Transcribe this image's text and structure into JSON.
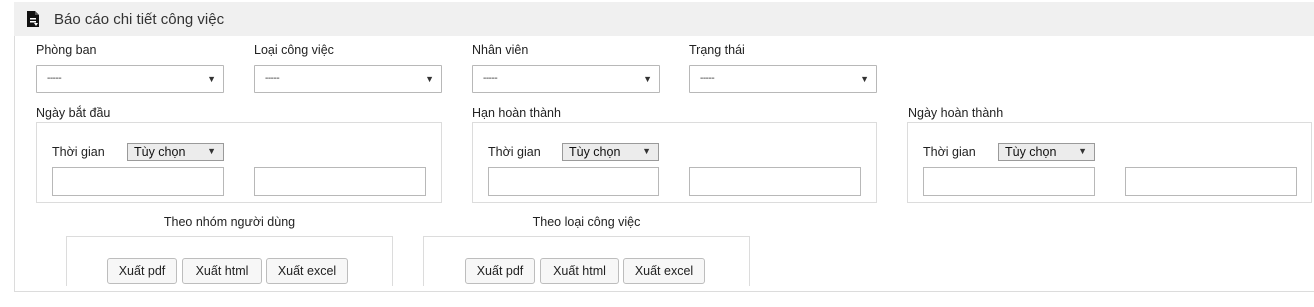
{
  "header": {
    "title": "Báo cáo chi tiết công việc",
    "icon": "report-document-icon"
  },
  "filters": {
    "department": {
      "label": "Phòng ban",
      "value": "-----"
    },
    "task_type": {
      "label": "Loại công việc",
      "value": "-----"
    },
    "employee": {
      "label": "Nhân viên",
      "value": "-----"
    },
    "status": {
      "label": "Trạng thái",
      "value": "-----"
    }
  },
  "date_groups": {
    "start_date": {
      "legend": "Ngày bắt đầu",
      "time_label": "Thời gian",
      "option": "Tùy chọn",
      "from_value": "",
      "to_value": ""
    },
    "deadline": {
      "legend": "Hạn hoàn thành",
      "time_label": "Thời gian",
      "option": "Tùy chọn",
      "from_value": "",
      "to_value": ""
    },
    "completed_date": {
      "legend": "Ngày hoàn thành",
      "time_label": "Thời gian",
      "option": "Tùy chọn",
      "from_value": "",
      "to_value": ""
    }
  },
  "exports": {
    "by_user_group": {
      "title": "Theo nhóm người dùng",
      "pdf": "Xuất pdf",
      "html": "Xuất html",
      "excel": "Xuất excel"
    },
    "by_task_type": {
      "title": "Theo loại công việc",
      "pdf": "Xuất pdf",
      "html": "Xuất html",
      "excel": "Xuất excel"
    }
  },
  "arrow_glyph": "▼"
}
